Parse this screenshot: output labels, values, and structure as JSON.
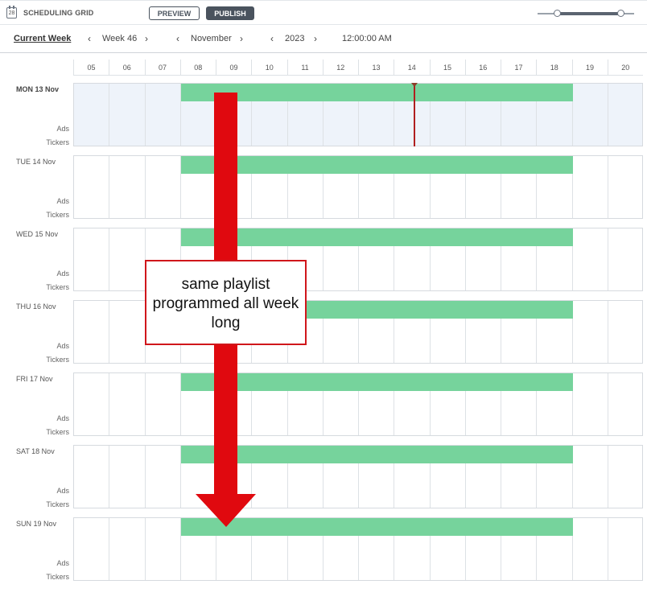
{
  "header": {
    "calendar_icon_number": "28",
    "title": "SCHEDULING GRID",
    "preview_label": "PREVIEW",
    "publish_label": "PUBLISH"
  },
  "nav": {
    "current_week": "Current Week",
    "week": "Week 46",
    "month": "November",
    "year": "2023",
    "time": "12:00:00 AM"
  },
  "hours": [
    "05",
    "06",
    "07",
    "08",
    "09",
    "10",
    "11",
    "12",
    "13",
    "14",
    "15",
    "16",
    "17",
    "18",
    "19",
    "20"
  ],
  "days": [
    {
      "label": "MON 13 Nov",
      "ads": "Ads",
      "tickers": "Tickers"
    },
    {
      "label": "TUE 14 Nov",
      "ads": "Ads",
      "tickers": "Tickers"
    },
    {
      "label": "WED 15 Nov",
      "ads": "Ads",
      "tickers": "Tickers"
    },
    {
      "label": "THU 16 Nov",
      "ads": "Ads",
      "tickers": "Tickers"
    },
    {
      "label": "FRI 17 Nov",
      "ads": "Ads",
      "tickers": "Tickers"
    },
    {
      "label": "SAT 18 Nov",
      "ads": "Ads",
      "tickers": "Tickers"
    },
    {
      "label": "SUN 19 Nov",
      "ads": "Ads",
      "tickers": "Tickers"
    }
  ],
  "annotation": {
    "text": "same playlist programmed all week long"
  },
  "colors": {
    "playlist_bar": "#76d39c",
    "today_background": "#eef3fa",
    "current_time_line": "#b01f1f",
    "annotation_red": "#e0090f"
  },
  "icons": {
    "calendar": "calendar-icon",
    "prev": "chevron-left-icon",
    "next": "chevron-right-icon"
  }
}
